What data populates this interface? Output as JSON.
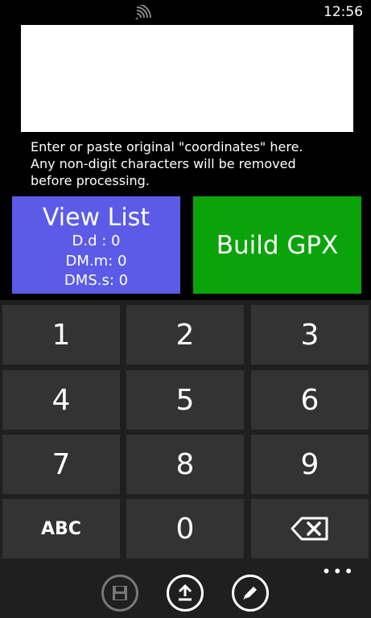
{
  "status_bar": {
    "time": "12:56",
    "signal_icon": "wifi-signal-icon"
  },
  "input": {
    "value": ""
  },
  "hint": {
    "lines": [
      "Enter or paste original \"coordinates\" here.",
      "Any non-digit characters will be removed",
      "before processing."
    ]
  },
  "view_list": {
    "title": "View List",
    "lines": [
      "D.d : 0",
      "DM.m: 0",
      "DMS.s: 0"
    ],
    "color": "#5b5be8"
  },
  "build_gpx": {
    "label": "Build GPX",
    "color": "#0aa40a"
  },
  "keypad": {
    "keys": [
      "1",
      "2",
      "3",
      "4",
      "5",
      "6",
      "7",
      "8",
      "9",
      "ABC",
      "0",
      "backspace-icon"
    ]
  },
  "app_bar": {
    "buttons": [
      "save-icon",
      "upload-icon",
      "edit-icon"
    ],
    "more": "•••"
  }
}
